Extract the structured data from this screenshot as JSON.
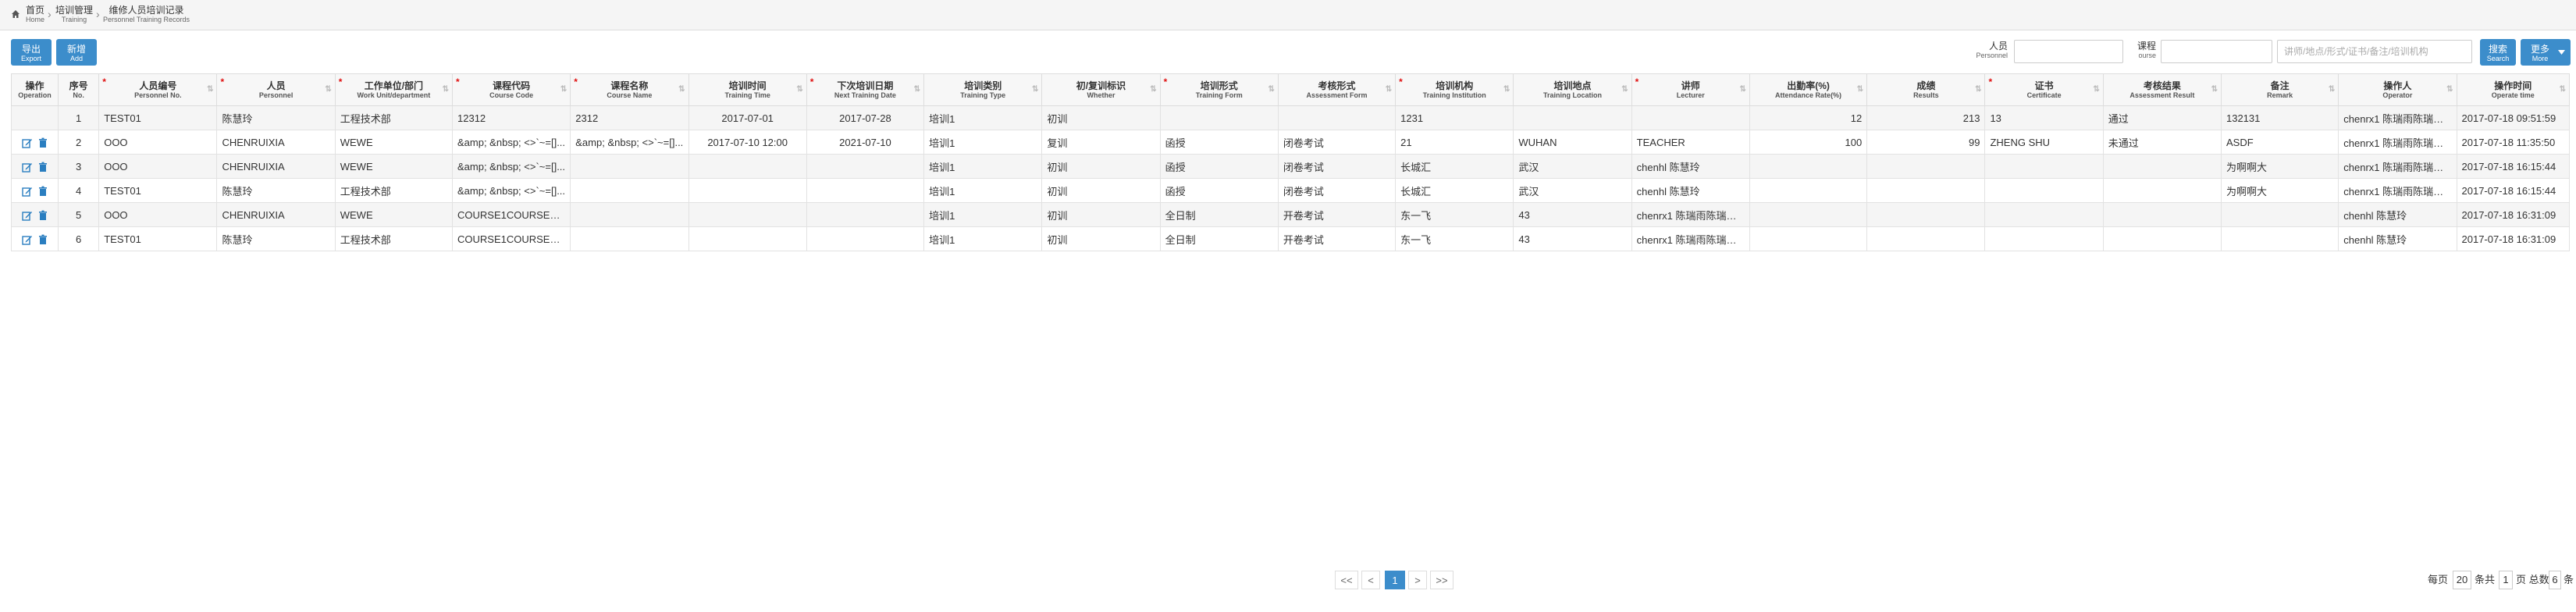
{
  "breadcrumb": [
    {
      "zh": "首页",
      "en": "Home"
    },
    {
      "zh": "培训管理",
      "en": "Training"
    },
    {
      "zh": "维修人员培训记录",
      "en": "Personnel Training Records"
    }
  ],
  "toolbar": {
    "export": {
      "zh": "导出",
      "en": "Export"
    },
    "add": {
      "zh": "新增",
      "en": "Add"
    }
  },
  "filters": {
    "personnel_label": {
      "zh": "人员",
      "en": "Personnel"
    },
    "course_label": {
      "zh": "课程",
      "en": "ourse"
    },
    "personnel_value": "",
    "course_value": "",
    "keyword_placeholder": "讲师/地点/形式/证书/备注/培训机构",
    "search": {
      "zh": "搜索",
      "en": "Search"
    },
    "more": {
      "zh": "更多",
      "en": "More"
    }
  },
  "columns": [
    {
      "zh": "操作",
      "en": "Operation",
      "req": false,
      "sort": false
    },
    {
      "zh": "序号",
      "en": "No.",
      "req": false,
      "sort": false
    },
    {
      "zh": "人员编号",
      "en": "Personnel No.",
      "req": true,
      "sort": true
    },
    {
      "zh": "人员",
      "en": "Personnel",
      "req": true,
      "sort": true
    },
    {
      "zh": "工作单位/部门",
      "en": "Work Unit/department",
      "req": true,
      "sort": true
    },
    {
      "zh": "课程代码",
      "en": "Course Code",
      "req": true,
      "sort": true
    },
    {
      "zh": "课程名称",
      "en": "Course Name",
      "req": true,
      "sort": true
    },
    {
      "zh": "培训时间",
      "en": "Training Time",
      "req": false,
      "sort": true
    },
    {
      "zh": "下次培训日期",
      "en": "Next Training Date",
      "req": true,
      "sort": true
    },
    {
      "zh": "培训类别",
      "en": "Training Type",
      "req": false,
      "sort": true
    },
    {
      "zh": "初/复训标识",
      "en": "Whether",
      "req": false,
      "sort": true
    },
    {
      "zh": "培训形式",
      "en": "Training Form",
      "req": true,
      "sort": true
    },
    {
      "zh": "考核形式",
      "en": "Assessment Form",
      "req": false,
      "sort": true
    },
    {
      "zh": "培训机构",
      "en": "Training Institution",
      "req": true,
      "sort": true
    },
    {
      "zh": "培训地点",
      "en": "Training Location",
      "req": false,
      "sort": true
    },
    {
      "zh": "讲师",
      "en": "Lecturer",
      "req": true,
      "sort": true
    },
    {
      "zh": "出勤率(%)",
      "en": "Attendance Rate(%)",
      "req": false,
      "sort": true
    },
    {
      "zh": "成绩",
      "en": "Results",
      "req": false,
      "sort": true
    },
    {
      "zh": "证书",
      "en": "Certificate",
      "req": true,
      "sort": true
    },
    {
      "zh": "考核结果",
      "en": "Assessment Result",
      "req": false,
      "sort": true
    },
    {
      "zh": "备注",
      "en": "Remark",
      "req": false,
      "sort": true
    },
    {
      "zh": "操作人",
      "en": "Operator",
      "req": false,
      "sort": true
    },
    {
      "zh": "操作时间",
      "en": "Operate time",
      "req": false,
      "sort": true
    }
  ],
  "rows": [
    {
      "no": "1",
      "personnel_no": "TEST01",
      "personnel": "陈慧玲",
      "unit": "工程技术部",
      "course_code": "12312",
      "course_name": "2312",
      "training_time": "2017-07-01",
      "next_date": "2017-07-28",
      "type": "培训1",
      "whether": "初训",
      "form": "",
      "assess_form": "",
      "institution": "1231",
      "location": "",
      "lecturer": "",
      "attendance": "12",
      "results": "213",
      "certificate": "13",
      "assess_result": "通过",
      "remark": "132131",
      "operator": "chenrx1 陈瑞雨陈瑞雨陈...",
      "operate_time": "2017-07-18 09:51:59",
      "actions": false
    },
    {
      "no": "2",
      "personnel_no": "OOO",
      "personnel": "CHENRUIXIA",
      "unit": "WEWE",
      "course_code": "&amp; &nbsp; <>`~=[]...",
      "course_name": "&amp; &nbsp; <>`~=[]...",
      "training_time": "2017-07-10 12:00",
      "next_date": "2021-07-10",
      "type": "培训1",
      "whether": "复训",
      "form": "函授",
      "assess_form": "闭卷考试",
      "institution": "21",
      "location": "WUHAN",
      "lecturer": "TEACHER",
      "attendance": "100",
      "results": "99",
      "certificate": "ZHENG SHU",
      "assess_result": "未通过",
      "remark": "ASDF",
      "operator": "chenrx1 陈瑞雨陈瑞雨陈...",
      "operate_time": "2017-07-18 11:35:50",
      "actions": true
    },
    {
      "no": "3",
      "personnel_no": "OOO",
      "personnel": "CHENRUIXIA",
      "unit": "WEWE",
      "course_code": "&amp; &nbsp; <>`~=[]...",
      "course_name": "",
      "training_time": "",
      "next_date": "",
      "type": "培训1",
      "whether": "初训",
      "form": "函授",
      "assess_form": "闭卷考试",
      "institution": "长城汇",
      "location": "武汉",
      "lecturer": "chenhl 陈慧玲",
      "attendance": "",
      "results": "",
      "certificate": "",
      "assess_result": "",
      "remark": "为啊啊大",
      "operator": "chenrx1 陈瑞雨陈瑞雨陈...",
      "operate_time": "2017-07-18 16:15:44",
      "actions": true
    },
    {
      "no": "4",
      "personnel_no": "TEST01",
      "personnel": "陈慧玲",
      "unit": "工程技术部",
      "course_code": "&amp; &nbsp; <>`~=[]...",
      "course_name": "",
      "training_time": "",
      "next_date": "",
      "type": "培训1",
      "whether": "初训",
      "form": "函授",
      "assess_form": "闭卷考试",
      "institution": "长城汇",
      "location": "武汉",
      "lecturer": "chenhl 陈慧玲",
      "attendance": "",
      "results": "",
      "certificate": "",
      "assess_result": "",
      "remark": "为啊啊大",
      "operator": "chenrx1 陈瑞雨陈瑞雨陈...",
      "operate_time": "2017-07-18 16:15:44",
      "actions": true
    },
    {
      "no": "5",
      "personnel_no": "OOO",
      "personnel": "CHENRUIXIA",
      "unit": "WEWE",
      "course_code": "COURSE1COURSE1CO...",
      "course_name": "",
      "training_time": "",
      "next_date": "",
      "type": "培训1",
      "whether": "初训",
      "form": "全日制",
      "assess_form": "开卷考试",
      "institution": "东一飞",
      "location": "43",
      "lecturer": "chenrx1 陈瑞雨陈瑞雨陈...",
      "attendance": "",
      "results": "",
      "certificate": "",
      "assess_result": "",
      "remark": "",
      "operator": "chenhl 陈慧玲",
      "operate_time": "2017-07-18 16:31:09",
      "actions": true
    },
    {
      "no": "6",
      "personnel_no": "TEST01",
      "personnel": "陈慧玲",
      "unit": "工程技术部",
      "course_code": "COURSE1COURSE1CO...",
      "course_name": "",
      "training_time": "",
      "next_date": "",
      "type": "培训1",
      "whether": "初训",
      "form": "全日制",
      "assess_form": "开卷考试",
      "institution": "东一飞",
      "location": "43",
      "lecturer": "chenrx1 陈瑞雨陈瑞雨陈...",
      "attendance": "",
      "results": "",
      "certificate": "",
      "assess_result": "",
      "remark": "",
      "operator": "chenhl 陈慧玲",
      "operate_time": "2017-07-18 16:31:09",
      "actions": true
    }
  ],
  "pagination": {
    "first": "<<",
    "prev": "<",
    "current": "1",
    "next": ">",
    "last": ">>",
    "per_page_label": "每页",
    "per_page_value": "20",
    "per_page_unit": "条共",
    "total_pages": "1",
    "pages_total_label": "页 总数",
    "total_count": "6",
    "count_unit": "条"
  },
  "colors": {
    "accent": "#3c8dcb",
    "required": "#e01010"
  },
  "icons": [
    "home-icon",
    "edit-icon",
    "delete-icon",
    "chevron-down-icon"
  ]
}
